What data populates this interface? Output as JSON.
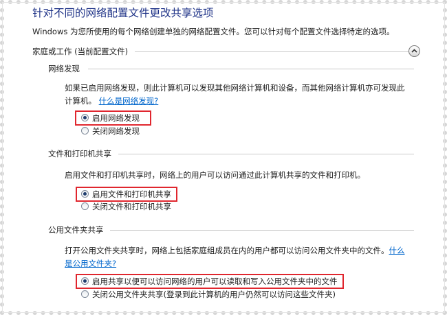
{
  "page": {
    "title": "针对不同的网络配置文件更改共享选项",
    "description": "Windows 为您所使用的每个网络创建单独的网络配置文件。您可以针对每个配置文件选择特定的选项。"
  },
  "profile": {
    "header": "家庭或工作 (当前配置文件)",
    "collapse_icon": "chevron-up-icon"
  },
  "network_discovery": {
    "title": "网络发现",
    "desc_line1": "如果已启用网络发现，则此计算机可以发现其他网络计算机和设备，而其他网络计算机亦可发现此",
    "desc_line2": "计算机。",
    "help_link": "什么是网络发现?",
    "options": [
      {
        "label": "启用网络发现",
        "checked": true
      },
      {
        "label": "关闭网络发现",
        "checked": false
      }
    ]
  },
  "file_printer_sharing": {
    "title": "文件和打印机共享",
    "desc": "启用文件和打印机共享时，网络上的用户可以访问通过此计算机共享的文件和打印机。",
    "options": [
      {
        "label": "启用文件和打印机共享",
        "checked": true
      },
      {
        "label": "关闭文件和打印机共享",
        "checked": false
      }
    ]
  },
  "public_folder_sharing": {
    "title": "公用文件夹共享",
    "desc_line1": "打开公用文件夹共享时，网络上包括家庭组成员在内的用户都可以访问公用文件夹中的文件。",
    "help_link_part1": "什么",
    "help_link_part2": "是公用文件夹?",
    "options": [
      {
        "label": "启用共享以便可以访问网络的用户可以读取和写入公用文件夹中的文件",
        "checked": true
      },
      {
        "label": "关闭公用文件夹共享(登录到此计算机的用户仍然可以访问这些文件夹)",
        "checked": false
      }
    ]
  },
  "colors": {
    "title": "#1e3287",
    "link": "#0066cc",
    "highlight": "#e0262e"
  }
}
